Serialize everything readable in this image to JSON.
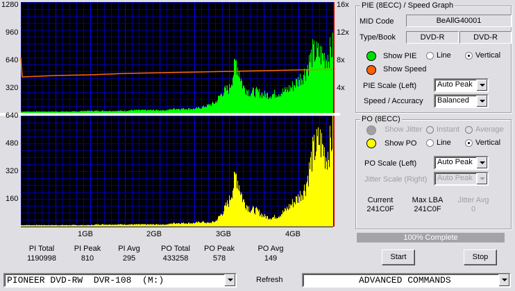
{
  "graph": {
    "pie_axis_left": [
      "1280",
      "960",
      "640",
      "320"
    ],
    "speed_axis_right": [
      "16x",
      "12x",
      "8x",
      "4x"
    ],
    "po_axis_left": [
      "640",
      "480",
      "320",
      "160"
    ],
    "x_ticks": [
      "1GB",
      "2GB",
      "3GB",
      "4GB"
    ],
    "colors": {
      "pie": "#00ff00",
      "po": "#ffff00",
      "speed": "#ff6a00",
      "grid": "#0000a0",
      "grid_major": "#0000ff",
      "bg": "#000000"
    }
  },
  "chart_data": [
    {
      "type": "bar",
      "title": "PIE (8ECC)",
      "xlabel": "GB",
      "x_step_gb": 0.1,
      "ylim": [
        0,
        1280
      ],
      "values": [
        16,
        16,
        16,
        16,
        16,
        16,
        16,
        16,
        16,
        24,
        24,
        24,
        24,
        24,
        24,
        24,
        32,
        32,
        32,
        32,
        32,
        32,
        48,
        48,
        48,
        48,
        64,
        88,
        120,
        240,
        280,
        600,
        300,
        240,
        240,
        210,
        210,
        230,
        250,
        300,
        380,
        480,
        690,
        680,
        640,
        770
      ]
    },
    {
      "type": "line",
      "title": "Speed",
      "ylabel": "x",
      "ylim": [
        0,
        16
      ],
      "points": [
        [
          0,
          8
        ],
        [
          0.02,
          5.2
        ],
        [
          0.5,
          5.4
        ],
        [
          1,
          5.5
        ],
        [
          1.5,
          5.7
        ],
        [
          2,
          5.8
        ],
        [
          2.5,
          5.9
        ],
        [
          3,
          6.0
        ],
        [
          3.5,
          6.1
        ],
        [
          4,
          6.2
        ],
        [
          4.5,
          6.3
        ]
      ]
    },
    {
      "type": "bar",
      "title": "PO (8ECC)",
      "xlabel": "GB",
      "x_step_gb": 0.1,
      "ylim": [
        0,
        640
      ],
      "values": [
        8,
        8,
        8,
        8,
        8,
        8,
        8,
        8,
        8,
        8,
        8,
        12,
        12,
        12,
        12,
        12,
        12,
        12,
        12,
        12,
        12,
        12,
        20,
        20,
        20,
        20,
        28,
        20,
        30,
        80,
        150,
        300,
        150,
        100,
        90,
        60,
        50,
        60,
        90,
        130,
        170,
        230,
        420,
        500,
        400,
        540
      ]
    }
  ],
  "stats": [
    {
      "label": "PI Total",
      "value": "1190998"
    },
    {
      "label": "PI Peak",
      "value": "810"
    },
    {
      "label": "PI Avg",
      "value": "295"
    },
    {
      "label": "PO Total",
      "value": "433258"
    },
    {
      "label": "PO Peak",
      "value": "578"
    },
    {
      "label": "PO Avg",
      "value": "149"
    }
  ],
  "pie_panel": {
    "title": "PIE (8ECC) / Speed Graph",
    "mid_label": "MID Code",
    "mid_value": "BeAllG40001",
    "type_label": "Type/Book",
    "type_value": "DVD-R",
    "book_value": "DVD-R",
    "show_pie": "Show PIE",
    "line": "Line",
    "vertical": "Vertical",
    "show_speed": "Show Speed",
    "scale_label": "PIE Scale (Left)",
    "scale_value": "Auto Peak",
    "speed_label": "Speed / Accuracy",
    "speed_value": "Balanced"
  },
  "po_panel": {
    "title": "PO (8ECC)",
    "show_jitter": "Show Jitter",
    "instant": "Instant",
    "average": "Average",
    "show_po": "Show PO",
    "line": "Line",
    "vertical": "Vertical",
    "scale_label": "PO Scale (Left)",
    "scale_value": "Auto Peak",
    "jitter_label": "Jitter Scale (Right)",
    "jitter_value": "Auto Peak",
    "current_label": "Current",
    "current_value": "241C0F",
    "maxlba_label": "Max LBA",
    "maxlba_value": "241C0F",
    "jitter_avg_label": "Jitter Avg",
    "jitter_avg_value": "0"
  },
  "progress": {
    "label": "100% Complete",
    "value": 1.0
  },
  "buttons": {
    "start": "Start",
    "stop": "Stop",
    "refresh": "Refresh"
  },
  "drive": "PIONEER DVD-RW  DVR-108  (M:)",
  "advanced": "ADVANCED COMMANDS"
}
